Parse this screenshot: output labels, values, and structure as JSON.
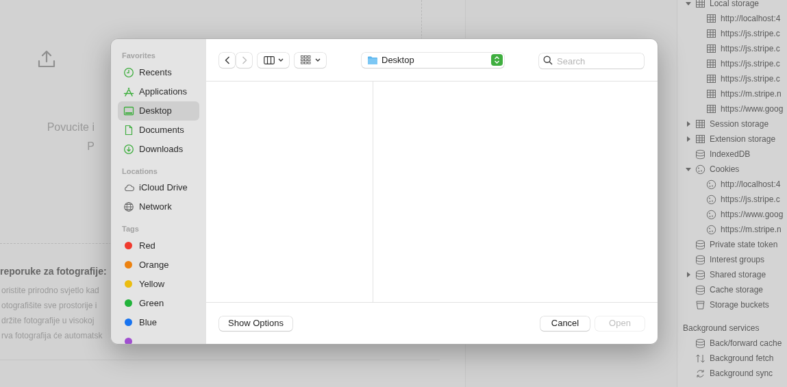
{
  "background_page": {
    "upload_hint": [
      "Povucite i",
      "P"
    ],
    "tips_title": "reporuke za fotografije:",
    "tips": [
      "oristite prirodno svjetlo kad",
      "otografišite sve prostorije i",
      "držite fotografije u visokoj",
      "rva fotografija će automatsk"
    ]
  },
  "devtools": {
    "storage_tree": [
      {
        "label": "Local storage",
        "kind": "table",
        "expanded": true,
        "children": [
          {
            "label": "http://localhost:4",
            "kind": "table"
          },
          {
            "label": "https://js.stripe.c",
            "kind": "table"
          },
          {
            "label": "https://js.stripe.c",
            "kind": "table"
          },
          {
            "label": "https://js.stripe.c",
            "kind": "table"
          },
          {
            "label": "https://js.stripe.c",
            "kind": "table"
          },
          {
            "label": "https://m.stripe.n",
            "kind": "table"
          },
          {
            "label": "https://www.goog",
            "kind": "table"
          }
        ]
      },
      {
        "label": "Session storage",
        "kind": "table",
        "expanded": false
      },
      {
        "label": "Extension storage",
        "kind": "table",
        "expanded": false
      },
      {
        "label": "IndexedDB",
        "kind": "database"
      },
      {
        "label": "Cookies",
        "kind": "cookie",
        "expanded": true,
        "children": [
          {
            "label": "http://localhost:4",
            "kind": "cookie"
          },
          {
            "label": "https://js.stripe.c",
            "kind": "cookie"
          },
          {
            "label": "https://www.goog",
            "kind": "cookie"
          },
          {
            "label": "https://m.stripe.n",
            "kind": "cookie"
          }
        ]
      },
      {
        "label": "Private state token",
        "kind": "database"
      },
      {
        "label": "Interest groups",
        "kind": "database"
      },
      {
        "label": "Shared storage",
        "kind": "database",
        "expanded": false
      },
      {
        "label": "Cache storage",
        "kind": "database"
      },
      {
        "label": "Storage buckets",
        "kind": "bucket"
      }
    ],
    "services_title": "Background services",
    "services": [
      {
        "label": "Back/forward cache",
        "kind": "database"
      },
      {
        "label": "Background fetch",
        "kind": "fetch"
      },
      {
        "label": "Background sync",
        "kind": "sync"
      }
    ]
  },
  "dialog": {
    "sidebar": [
      {
        "heading": "Favorites",
        "items": [
          {
            "label": "Recents",
            "kind": "clock",
            "selected": false
          },
          {
            "label": "Applications",
            "kind": "apps",
            "selected": false
          },
          {
            "label": "Desktop",
            "kind": "desktop",
            "selected": true
          },
          {
            "label": "Documents",
            "kind": "doc",
            "selected": false
          },
          {
            "label": "Downloads",
            "kind": "download",
            "selected": false
          }
        ]
      },
      {
        "heading": "Locations",
        "items": [
          {
            "label": "iCloud Drive",
            "kind": "cloud",
            "selected": false
          },
          {
            "label": "Network",
            "kind": "globe",
            "selected": false
          }
        ]
      },
      {
        "heading": "Tags",
        "items": [
          {
            "label": "Red",
            "kind": "tag",
            "color": "#f03a2e",
            "selected": false
          },
          {
            "label": "Orange",
            "kind": "tag",
            "color": "#ec8210",
            "selected": false
          },
          {
            "label": "Yellow",
            "kind": "tag",
            "color": "#ebbd10",
            "selected": false
          },
          {
            "label": "Green",
            "kind": "tag",
            "color": "#22b33b",
            "selected": false
          },
          {
            "label": "Blue",
            "kind": "tag",
            "color": "#1874f0",
            "selected": false
          },
          {
            "kind": "tag",
            "color": "#a04fd0",
            "selected": false
          }
        ]
      }
    ],
    "location": "Desktop",
    "search": {
      "placeholder": "Search"
    },
    "back_enabled": true,
    "forward_enabled": false,
    "footer": {
      "options_button": "Show Options",
      "cancel_button": "Cancel",
      "open_button": {
        "label": "Open",
        "disabled": true
      }
    }
  }
}
